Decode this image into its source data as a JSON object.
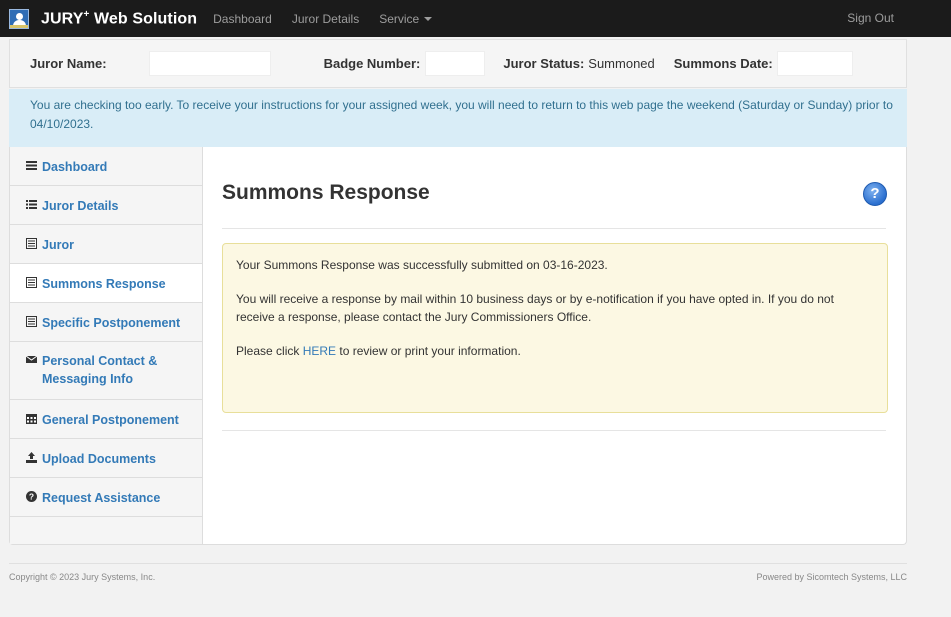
{
  "navbar": {
    "brand_main": "JURY",
    "brand_sup": "+",
    "brand_rest": " Web Solution",
    "links": [
      "Dashboard",
      "Juror Details",
      "Service"
    ],
    "signout": "Sign Out"
  },
  "info_bar": {
    "juror_name_label": "Juror Name:",
    "badge_number_label": "Badge Number:",
    "juror_status_label": "Juror Status:",
    "juror_status_value": "Summoned",
    "summons_date_label": "Summons Date:"
  },
  "notice": "You are checking too early. To receive your instructions for your assigned week, you will need to return to this web page the weekend (Saturday or Sunday) prior to 04/10/2023.",
  "sidebar": {
    "items": [
      {
        "label": "Dashboard",
        "icon": "list-icon"
      },
      {
        "label": "Juror Details",
        "icon": "list-alt-icon"
      },
      {
        "label": "Juror",
        "icon": "form-icon"
      },
      {
        "label": "Summons Response",
        "icon": "form-icon"
      },
      {
        "label": "Specific Postponement",
        "icon": "form-icon"
      },
      {
        "label": "Personal Contact & Messaging Info",
        "icon": "envelope-icon"
      },
      {
        "label": "General Postponement",
        "icon": "calendar-icon"
      },
      {
        "label": "Upload Documents",
        "icon": "upload-icon"
      },
      {
        "label": "Request Assistance",
        "icon": "question-circle-icon"
      }
    ]
  },
  "main": {
    "title": "Summons Response",
    "help_glyph": "?",
    "msg1": "Your Summons Response was successfully submitted on 03-16-2023.",
    "msg2": "You will receive a response by mail within 10 business days or by e-notification if you have opted in.  If you do not receive a response, please contact the Jury Commissioners Office.",
    "msg3_pre": "Please click ",
    "msg3_link": "HERE",
    "msg3_post": " to review or print your information."
  },
  "footer": {
    "left": "Copyright © 2023 Jury Systems, Inc.",
    "right": "Powered by Sicomtech Systems, LLC"
  }
}
